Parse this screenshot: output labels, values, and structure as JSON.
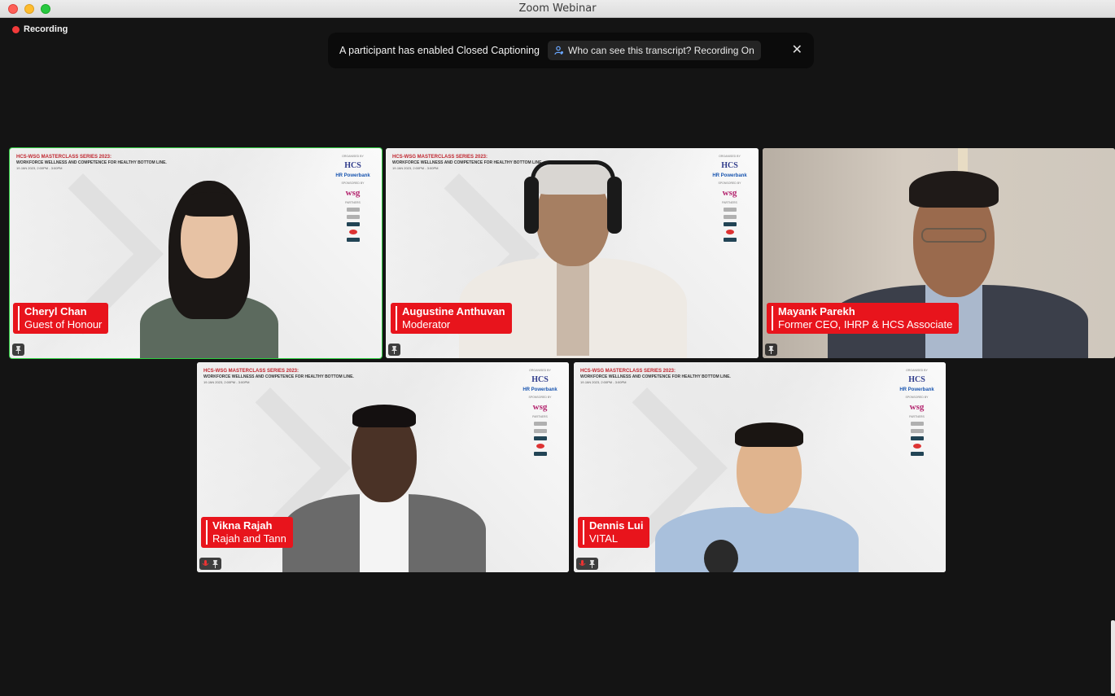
{
  "window": {
    "title": "Zoom Webinar"
  },
  "recording": {
    "label": "Recording"
  },
  "caption_banner": {
    "message": "A participant has enabled Closed Captioning",
    "link": "Who can see this transcript? Recording On"
  },
  "slide": {
    "line1": "HCS-WSG MASTERCLASS SERIES 2023:",
    "line2": "WORKFORCE WELLNESS AND COMPETENCE FOR HEALTHY BOTTOM LINE.",
    "line3": "19 JAN 2023, 2:00PM - 3:00PM",
    "organised_by": "ORGANISED BY",
    "hcs": "HCS",
    "hr_powerbank": "HR Powerbank",
    "sponsored_by": "SPONSORED BY",
    "wsg": "wsg",
    "partners": "PARTNERS"
  },
  "participants": [
    {
      "name": "Cheryl Chan",
      "role": "Guest of Honour"
    },
    {
      "name": "Augustine Anthuvan",
      "role": "Moderator"
    },
    {
      "name": "Mayank Parekh",
      "role": "Former CEO, IHRP & HCS Associate"
    },
    {
      "name": "Vikna Rajah",
      "role": "Rajah and Tann"
    },
    {
      "name": "Dennis Lui",
      "role": "VITAL"
    }
  ]
}
